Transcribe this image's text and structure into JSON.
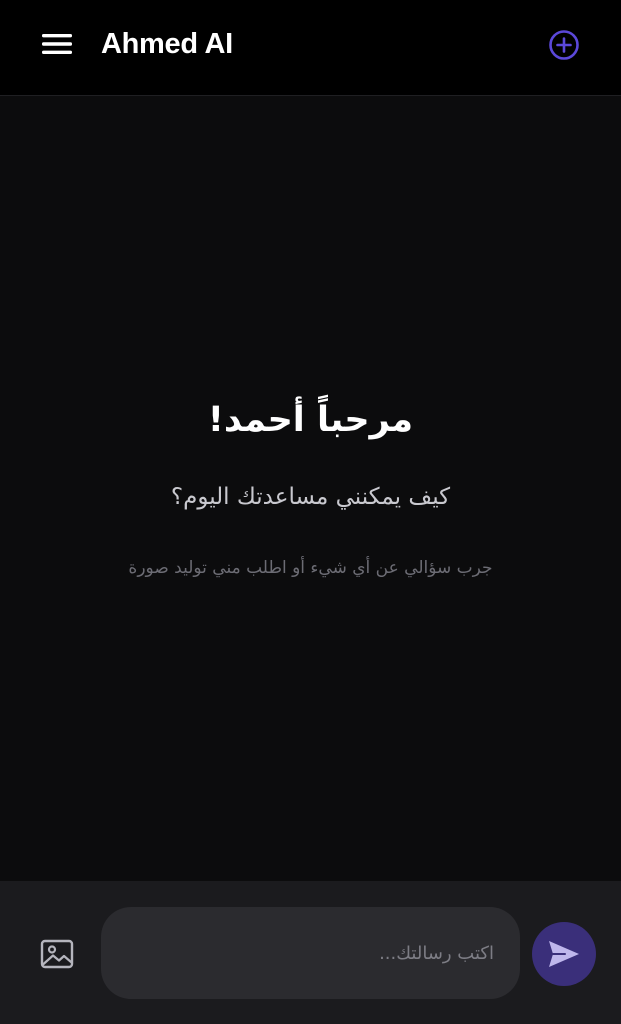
{
  "header": {
    "title": "Ahmed AI",
    "menu_icon": "menu-icon",
    "new_chat_icon": "plus-circle-icon"
  },
  "welcome": {
    "title": "مرحباً أحمد!",
    "subtitle": "كيف يمكنني مساعدتك اليوم؟",
    "hint": "جرب سؤالي عن أي شيء أو اطلب مني توليد صورة"
  },
  "composer": {
    "placeholder": "اكتب رسالتك...",
    "value": "",
    "image_icon": "image-icon",
    "send_icon": "send-icon"
  },
  "colors": {
    "accent": "#5b48d9",
    "header_bg": "#000000",
    "content_bg": "#0c0c0d",
    "composer_bg": "#1b1b1e",
    "input_bg": "#2b2b2f",
    "send_bg": "#3a2f7a"
  }
}
